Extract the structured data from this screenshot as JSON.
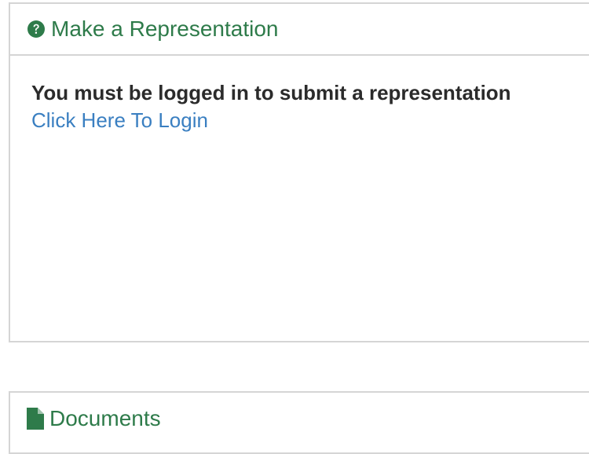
{
  "representation_panel": {
    "icon": "question-circle-icon",
    "title": "Make a Representation",
    "message": "You must be logged in to submit a representation",
    "login_link": "Click Here To Login"
  },
  "documents_panel": {
    "icon": "document-icon",
    "title": "Documents"
  },
  "colors": {
    "heading_green": "#2e7b4a",
    "link_blue": "#3a7fc1",
    "text_dark": "#2b2b2b",
    "border_grey": "#d5d5d5"
  }
}
